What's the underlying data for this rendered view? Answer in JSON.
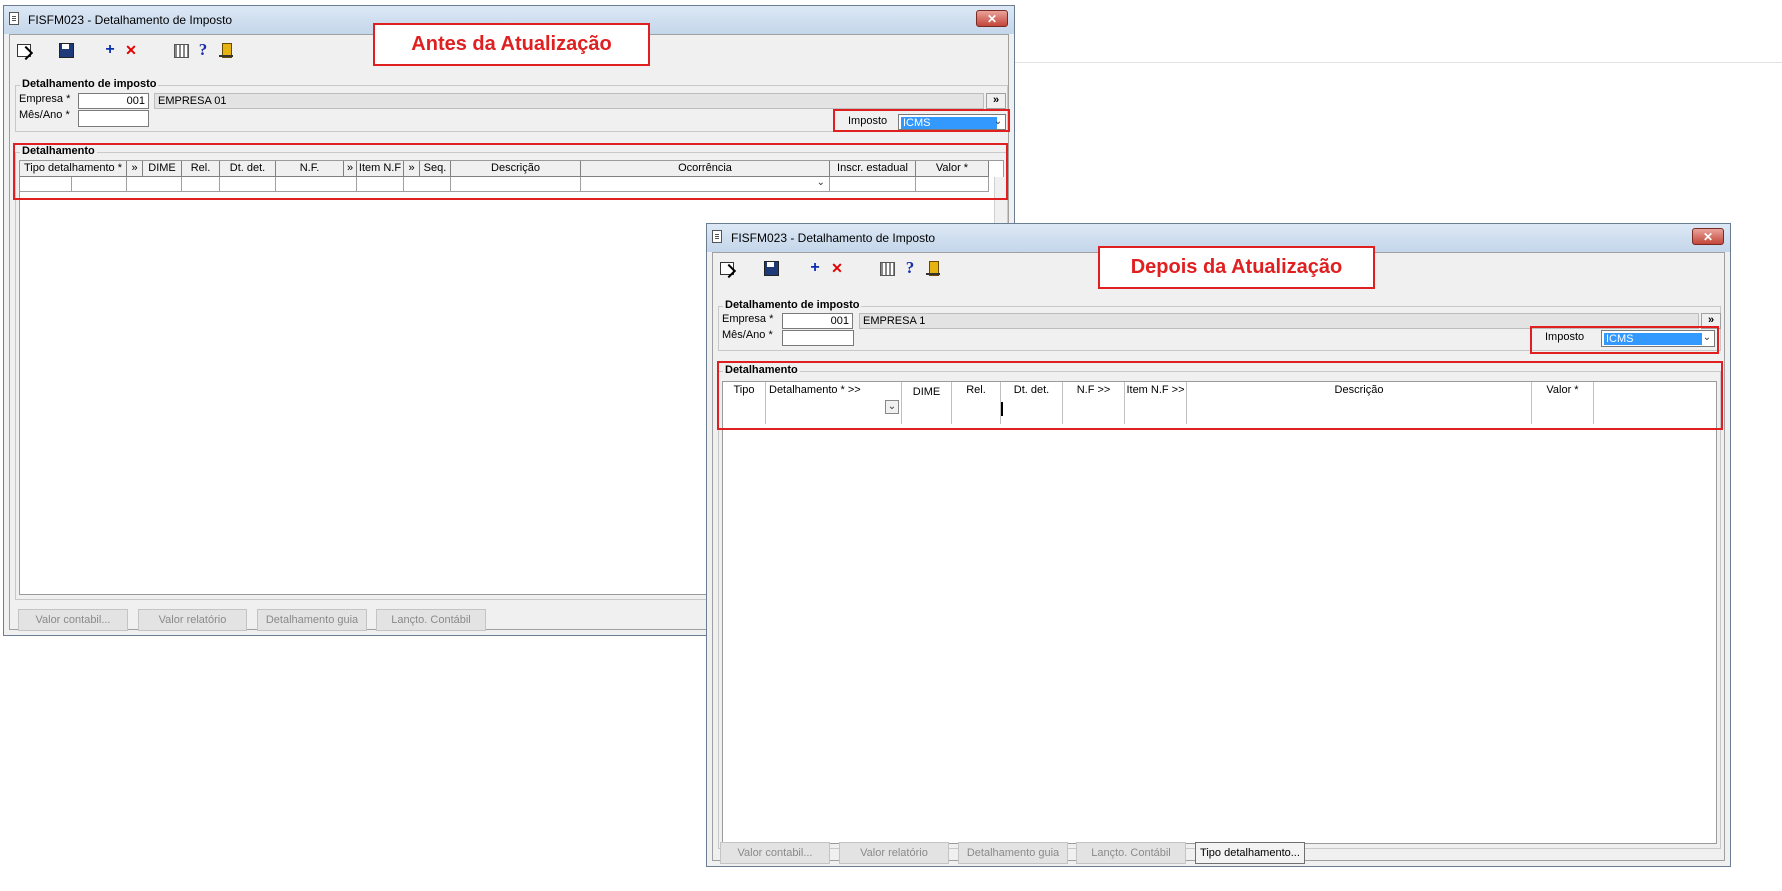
{
  "annotations": {
    "before": "Antes da Atualização",
    "after": "Depois da Atualização"
  },
  "window": {
    "title": "FISFM023 - Detalhamento de Imposto",
    "close": "✕"
  },
  "toolbar": {
    "plus": "+",
    "delete": "✕",
    "help": "?"
  },
  "form": {
    "legend": "Detalhamento de imposto",
    "empresa_label": "Empresa *",
    "empresa_code": "001",
    "mes_label": "Mês/Ano *",
    "mes_value": "",
    "more": "»",
    "imposto_label": "Imposto",
    "imposto_value": "ICMS"
  },
  "before": {
    "empresa_name": "EMPRESA 01",
    "detalhamento_legend": "Detalhamento",
    "columns": [
      "Tipo detalhamento *",
      "»",
      "DIME",
      "Rel.",
      "Dt. det.",
      "N.F.",
      "»",
      "Item N.F",
      "»",
      "Seq.",
      "Descrição",
      "Ocorrência",
      "Inscr. estadual",
      "Valor *"
    ],
    "buttons": [
      "Valor contabil...",
      "Valor relatório",
      "Detalhamento guia",
      "Lançto. Contábil"
    ]
  },
  "after": {
    "empresa_name": "EMPRESA 1",
    "detalhamento_legend": "Detalhamento",
    "columns": [
      "Tipo",
      "Detalhamento * >>",
      "DIME",
      "Rel.",
      "Dt. det.",
      "N.F >>",
      "Item N.F >>",
      "Descrição",
      "Valor *"
    ],
    "buttons": [
      "Valor contabil...",
      "Valor relatório",
      "Detalhamento guia",
      "Lançto. Contábil",
      "Tipo detalhamento..."
    ]
  }
}
